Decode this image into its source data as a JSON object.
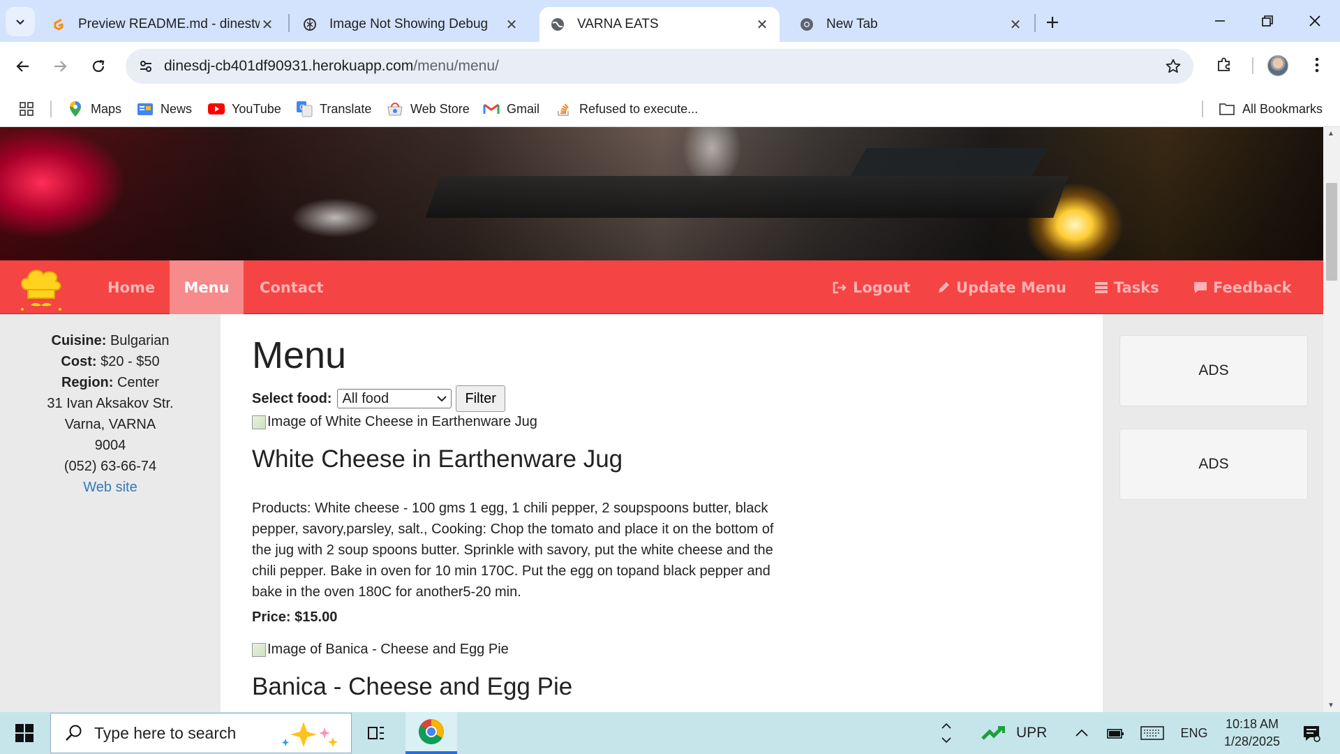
{
  "browser": {
    "tabs": [
      {
        "title": "Preview README.md - dinestw",
        "active": false
      },
      {
        "title": "Image Not Showing Debug",
        "active": false
      },
      {
        "title": "VARNA EATS",
        "active": true
      },
      {
        "title": "New Tab",
        "active": false
      }
    ],
    "url_host": "dinesdj-cb401df90931.herokuapp.com",
    "url_path": "/menu/menu/",
    "bookmarks": [
      {
        "label": "Maps",
        "icon": "maps-pin-icon"
      },
      {
        "label": "News",
        "icon": "news-icon"
      },
      {
        "label": "YouTube",
        "icon": "youtube-icon"
      },
      {
        "label": "Translate",
        "icon": "translate-icon"
      },
      {
        "label": "Web Store",
        "icon": "web-store-icon"
      },
      {
        "label": "Gmail",
        "icon": "gmail-icon"
      },
      {
        "label": "Refused to execute...",
        "icon": "stackoverflow-icon"
      }
    ],
    "all_bookmarks": "All Bookmarks"
  },
  "site": {
    "nav": {
      "home": "Home",
      "menu": "Menu",
      "contact": "Contact",
      "logout": "Logout",
      "update_menu": "Update Menu",
      "tasks": "Tasks",
      "feedback": "Feedback"
    },
    "restaurant": {
      "cuisine_label": "Cuisine:",
      "cuisine": "Bulgarian",
      "cost_label": "Cost:",
      "cost": "$20 - $50",
      "region_label": "Region:",
      "region": "Center",
      "street": "31 Ivan Aksakov Str.",
      "city": "Varna, VARNA",
      "zip": "9004",
      "phone": "(052) 63-66-74",
      "website": "Web site"
    },
    "page_title": "Menu",
    "filter": {
      "label": "Select food:",
      "selected": "All food",
      "button": "Filter"
    },
    "dishes": [
      {
        "image_alt": "Image of White Cheese in Earthenware Jug",
        "title": "White Cheese in Earthenware Jug",
        "description": "Products: White cheese - 100 gms 1 egg, 1 chili pepper, 2 soupspoons butter, black pepper, savory,parsley, salt., Cooking: Chop the tomato and place it on the bottom of the jug with 2 soup spoons butter. Sprinkle with savory, put the white cheese and the chili pepper. Bake in oven for 10 min 170C. Put the egg on topand black pepper and bake in the oven 180C for another5-20 min.",
        "price": "Price: $15.00"
      },
      {
        "image_alt": "Image of Banica - Cheese and Egg Pie",
        "title": "Banica - Cheese and Egg Pie"
      }
    ],
    "ads": [
      "ADS",
      "ADS"
    ]
  },
  "taskbar": {
    "search_placeholder": "Type here to search",
    "stock_label": "UPR",
    "language": "ENG",
    "time": "10:18 AM",
    "date": "1/28/2025"
  },
  "colors": {
    "nav_bg": "#f44444",
    "nav_active_bg": "#f78a8a",
    "link": "#337ab7",
    "taskbar_bg": "#c5e5eb"
  }
}
